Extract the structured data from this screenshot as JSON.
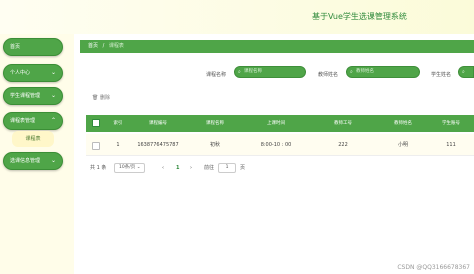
{
  "header": {
    "title": "基于Vue学生选课管理系统"
  },
  "sidebar": {
    "items": [
      {
        "label": "首页",
        "chevron": ""
      },
      {
        "label": "个人中心",
        "chevron": "⌄"
      },
      {
        "label": "学生课程管理",
        "chevron": "⌄"
      },
      {
        "label": "课程表管理",
        "chevron": "⌃"
      },
      {
        "label": "选课信息管理",
        "chevron": "⌄"
      }
    ],
    "submenu": {
      "label": "课程表"
    }
  },
  "breadcrumb": {
    "home": "首页",
    "separator": "/",
    "current": "课程表"
  },
  "search": {
    "fields": [
      {
        "label": "课程名称",
        "placeholder": "课程名称"
      },
      {
        "label": "教师姓名",
        "placeholder": "教师姓名"
      },
      {
        "label": "学生姓名",
        "placeholder": ""
      }
    ]
  },
  "toolbar": {
    "delete_label": "删除"
  },
  "table": {
    "headers": [
      "索引",
      "课程编号",
      "课程名称",
      "上课时间",
      "教师工号",
      "教师姓名",
      "学生账号"
    ],
    "rows": [
      [
        "1",
        "1638776475787",
        "初秋",
        "8:00-10 : 00",
        "222",
        "小明",
        "111"
      ]
    ]
  },
  "pagination": {
    "total": "共 1 条",
    "page_size": "10条/页",
    "prev": "‹",
    "current": "1",
    "next": "›",
    "goto_prefix": "前往",
    "goto_value": "1",
    "goto_suffix": "页"
  },
  "watermark": "CSDN @QQ3166678367",
  "icons": {
    "search": "search-icon",
    "delete": "trash-icon"
  },
  "colors": {
    "accent": "#4fa548",
    "accent_dark": "#2f8a3b",
    "background": "#fffde9"
  }
}
